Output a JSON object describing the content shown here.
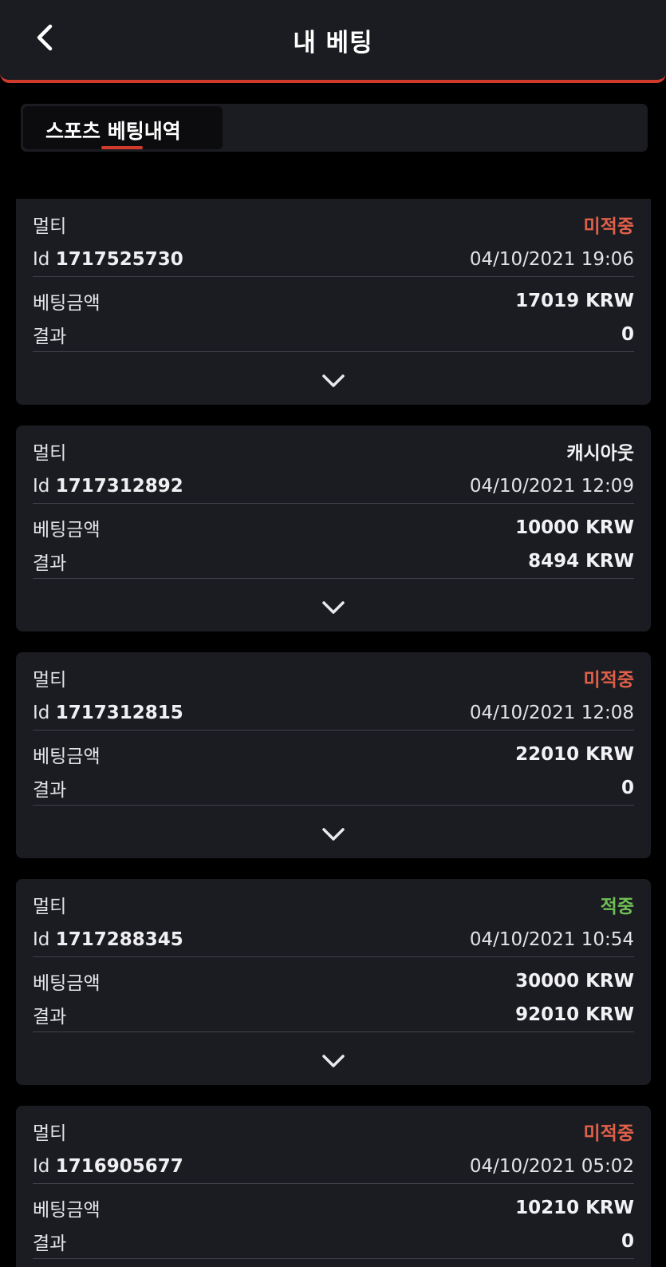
{
  "header": {
    "title": "내 베팅",
    "back_icon": "chevron-left-icon"
  },
  "tabs": [
    {
      "label": "스포츠 베팅내역",
      "active": true
    }
  ],
  "colors": {
    "accent": "#d13b2c",
    "pending": "#e0604a",
    "win": "#6fbf55",
    "card_bg": "#1b1c21",
    "page_bg": "#000000"
  },
  "bets": [
    {
      "type": "멀티",
      "status": "미적중",
      "status_kind": "pending",
      "id_label": "Id",
      "id": "1717525730",
      "datetime": "04/10/2021 19:06",
      "amount_label": "베팅금액",
      "amount": "17019 KRW",
      "result_label": "결과",
      "result": "0"
    },
    {
      "type": "멀티",
      "status": "캐시아웃",
      "status_kind": "cashout",
      "id_label": "Id",
      "id": "1717312892",
      "datetime": "04/10/2021 12:09",
      "amount_label": "베팅금액",
      "amount": "10000 KRW",
      "result_label": "결과",
      "result": "8494 KRW"
    },
    {
      "type": "멀티",
      "status": "미적중",
      "status_kind": "pending",
      "id_label": "Id",
      "id": "1717312815",
      "datetime": "04/10/2021 12:08",
      "amount_label": "베팅금액",
      "amount": "22010 KRW",
      "result_label": "결과",
      "result": "0"
    },
    {
      "type": "멀티",
      "status": "적중",
      "status_kind": "win",
      "id_label": "Id",
      "id": "1717288345",
      "datetime": "04/10/2021 10:54",
      "amount_label": "베팅금액",
      "amount": "30000 KRW",
      "result_label": "결과",
      "result": "92010 KRW"
    },
    {
      "type": "멀티",
      "status": "미적중",
      "status_kind": "pending",
      "id_label": "Id",
      "id": "1716905677",
      "datetime": "04/10/2021 05:02",
      "amount_label": "베팅금액",
      "amount": "10210 KRW",
      "result_label": "결과",
      "result": "0"
    }
  ]
}
